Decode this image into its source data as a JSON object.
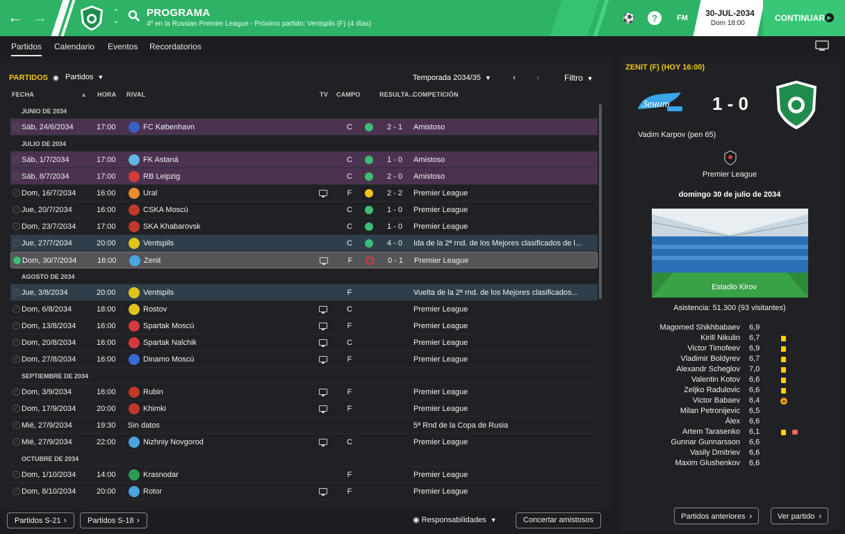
{
  "header": {
    "title": "PROGRAMA",
    "subtitle": "4º en la Russian Premier League - Próximo partido: Ventspils (F)  (4 días)",
    "date": "30-JUL-2034",
    "day": "Dom 18:00",
    "continue_label": "CONTINUAR",
    "fm_label": "FM"
  },
  "tabs": [
    "Partidos",
    "Calendario",
    "Eventos",
    "Recordatorios"
  ],
  "toolbar": {
    "title": "PARTIDOS",
    "view_select": "Partidos",
    "season": "Temporada 2034/35",
    "filter": "Filtro"
  },
  "columns": {
    "fecha": "FECHA",
    "hora": "HORA",
    "rival": "RIVAL",
    "tv": "TV",
    "campo": "CAMPO",
    "resultado": "RESULTA...",
    "competicion": "COMPETICIÓN"
  },
  "months": [
    "JUNIO DE 2034",
    "JULIO DE 2034",
    "AGOSTO DE 2034",
    "SEPTIEMBRE DE 2034",
    "OCTUBRE DE 2034"
  ],
  "fixtures": [
    {
      "date": "Sáb, 24/6/2034",
      "time": "17:00",
      "opponent": "FC København",
      "tv": false,
      "campo": "C",
      "result": "win",
      "score": "2 - 1",
      "competition": "Amistoso",
      "style": "friendly",
      "logo": "#3a5fc2"
    },
    {
      "date": "Sáb, 1/7/2034",
      "time": "17:00",
      "opponent": "FK Astaná",
      "tv": false,
      "campo": "C",
      "result": "win",
      "score": "1 - 0",
      "competition": "Amistoso",
      "style": "friendly",
      "logo": "#5fb6e0"
    },
    {
      "date": "Sáb, 8/7/2034",
      "time": "17:00",
      "opponent": "RB Leipzig",
      "tv": false,
      "campo": "C",
      "result": "win",
      "score": "2 - 0",
      "competition": "Amistoso",
      "style": "friendly",
      "logo": "#d33a3a"
    },
    {
      "date": "Dom, 16/7/2034",
      "time": "16:00",
      "opponent": "Ural",
      "tv": true,
      "campo": "F",
      "result": "draw",
      "score": "2 - 2",
      "competition": "Premier League",
      "style": "",
      "logo": "#e88a2e"
    },
    {
      "date": "Jue, 20/7/2034",
      "time": "16:00",
      "opponent": "CSKA Moscú",
      "tv": false,
      "campo": "C",
      "result": "win",
      "score": "1 - 0",
      "competition": "Premier League",
      "style": "",
      "logo": "#c0392b"
    },
    {
      "date": "Dom, 23/7/2034",
      "time": "17:00",
      "opponent": "SKA Khabarovsk",
      "tv": false,
      "campo": "C",
      "result": "win",
      "score": "1 - 0",
      "competition": "Premier League",
      "style": "",
      "logo": "#c0392b"
    },
    {
      "date": "Jue, 27/7/2034",
      "time": "20:00",
      "opponent": "Ventspils",
      "tv": false,
      "campo": "C",
      "result": "win",
      "score": "4 - 0",
      "competition": "Ida de la 2ª rnd. de los Mejores clasificados de l...",
      "style": "cup",
      "logo": "#e0c21a"
    },
    {
      "date": "Dom, 30/7/2034",
      "time": "16:00",
      "opponent": "Zenit",
      "tv": true,
      "campo": "F",
      "result": "loss",
      "score": "0 - 1",
      "competition": "Premier League",
      "style": "cur",
      "logo": "#4ba3e0"
    },
    {
      "date": "Jue, 3/8/2034",
      "time": "20:00",
      "opponent": "Ventspils",
      "tv": false,
      "campo": "F",
      "result": "",
      "score": "",
      "competition": "Vuelta de la 2ª rnd. de los Mejores clasificados...",
      "style": "cup",
      "logo": "#e0c21a"
    },
    {
      "date": "Dom, 6/8/2034",
      "time": "18:00",
      "opponent": "Rostov",
      "tv": true,
      "campo": "C",
      "result": "",
      "score": "",
      "competition": "Premier League",
      "style": "",
      "logo": "#e0c21a"
    },
    {
      "date": "Dom, 13/8/2034",
      "time": "16:00",
      "opponent": "Spartak Moscú",
      "tv": true,
      "campo": "F",
      "result": "",
      "score": "",
      "competition": "Premier League",
      "style": "",
      "logo": "#d33a3a"
    },
    {
      "date": "Dom, 20/8/2034",
      "time": "16:00",
      "opponent": "Spartak Nalchik",
      "tv": true,
      "campo": "C",
      "result": "",
      "score": "",
      "competition": "Premier League",
      "style": "",
      "logo": "#d33a3a"
    },
    {
      "date": "Dom, 27/8/2034",
      "time": "16:00",
      "opponent": "Dinamo Moscú",
      "tv": true,
      "campo": "F",
      "result": "",
      "score": "",
      "competition": "Premier League",
      "style": "",
      "logo": "#3a6ad3"
    },
    {
      "date": "Dom, 3/9/2034",
      "time": "16:00",
      "opponent": "Rubin",
      "tv": true,
      "campo": "F",
      "result": "",
      "score": "",
      "competition": "Premier League",
      "style": "",
      "logo": "#c0392b"
    },
    {
      "date": "Dom, 17/9/2034",
      "time": "20:00",
      "opponent": "Khimki",
      "tv": true,
      "campo": "F",
      "result": "",
      "score": "",
      "competition": "Premier League",
      "style": "",
      "logo": "#c0392b"
    },
    {
      "date": "Mié, 27/9/2034",
      "time": "19:30",
      "opponent": "Sin datos",
      "tv": false,
      "campo": "",
      "result": "",
      "score": "",
      "competition": "5ª Rnd de la Copa de Rusia",
      "style": "nodata",
      "logo": ""
    },
    {
      "date": "Mié, 27/9/2034",
      "time": "22:00",
      "opponent": "Nizhniy Novgorod",
      "tv": true,
      "campo": "C",
      "result": "",
      "score": "",
      "competition": "Premier League",
      "style": "",
      "logo": "#4ba3e0"
    },
    {
      "date": "Dom, 1/10/2034",
      "time": "14:00",
      "opponent": "Krasnodar",
      "tv": false,
      "campo": "F",
      "result": "",
      "score": "",
      "competition": "Premier League",
      "style": "",
      "logo": "#2e9b56"
    },
    {
      "date": "Dom, 8/10/2034",
      "time": "20:00",
      "opponent": "Rotor",
      "tv": true,
      "campo": "F",
      "result": "",
      "score": "",
      "competition": "Premier League",
      "style": "",
      "logo": "#4ba3e0"
    }
  ],
  "bottom": {
    "u21": "Partidos S-21",
    "u18": "Partidos S-18",
    "responsibilities": "Responsabilidades",
    "friendlies": "Concertar amistosos"
  },
  "side": {
    "title": "ZENIT (F)  (HOY 16:00)",
    "score": "1 - 0",
    "home_logo_text": "Зенит",
    "scorer": "Vadim Karpov (pen 65)",
    "league": "Premier League",
    "date": "domingo 30 de julio de 2034",
    "stadium": "Estadio Kirov",
    "attendance": "Asistencia: 51.300 (93 visitantes)",
    "players": [
      {
        "name": "Magomed Shikhbabaev",
        "rating": "6,9",
        "mark": ""
      },
      {
        "name": "Kirill Nikulin",
        "rating": "6,7",
        "mark": "yellow"
      },
      {
        "name": "Victor Timofeev",
        "rating": "6,9",
        "mark": "yellow"
      },
      {
        "name": "Vladimir Boldyrev",
        "rating": "6,7",
        "mark": "yellow"
      },
      {
        "name": "Alexandr Scheglov",
        "rating": "7,0",
        "mark": "yellow"
      },
      {
        "name": "Valentin Kotov",
        "rating": "6,6",
        "mark": "yellow"
      },
      {
        "name": "Zeljko Radulovic",
        "rating": "6,6",
        "mark": "yellow"
      },
      {
        "name": "Victor Babaev",
        "rating": "6,4",
        "mark": "sub"
      },
      {
        "name": "Milan Petronijevic",
        "rating": "6,5",
        "mark": ""
      },
      {
        "name": "Álex",
        "rating": "6,6",
        "mark": ""
      },
      {
        "name": "Artem Tarasenko",
        "rating": "6,1",
        "mark": "yellow-injury"
      },
      {
        "name": "Gunnar Gunnarsson",
        "rating": "6,6",
        "mark": ""
      },
      {
        "name": "Vasily Dmitriev",
        "rating": "6,6",
        "mark": ""
      },
      {
        "name": "Maxim Glushenkov",
        "rating": "6,6",
        "mark": ""
      }
    ],
    "prev_button": "Partidos anteriores",
    "view_button": "Ver partido"
  },
  "colors": {
    "accent_green": "#2eb266",
    "highlight_yellow": "#f0c419",
    "win": "#3bbd78",
    "loss": "#d93a3a",
    "friendly_row": "#4b3350",
    "cup_row": "#2e3f4b"
  }
}
